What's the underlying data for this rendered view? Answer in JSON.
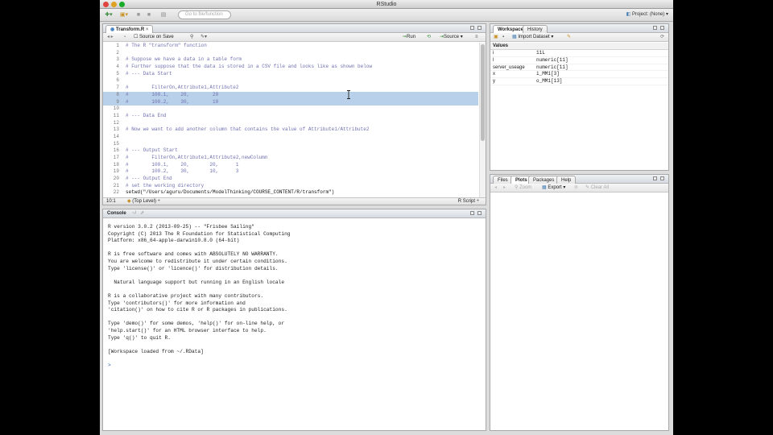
{
  "window": {
    "title": "RStudio"
  },
  "toolbar": {
    "goto_placeholder": "Go to file/function",
    "project": "Project: (None)"
  },
  "editor": {
    "tab": "Transform.R",
    "source_on_save": "Source on Save",
    "run": "Run",
    "source": "Source",
    "lines": [
      {
        "n": "1",
        "text": "# The R \"transform\" function",
        "kind": "comment",
        "sel": false
      },
      {
        "n": "2",
        "text": "",
        "kind": "plain",
        "sel": false
      },
      {
        "n": "3",
        "text": "# Suppose we have a data in a table form",
        "kind": "comment",
        "sel": false
      },
      {
        "n": "4",
        "text": "# Further suppose that the data is stored in a CSV file and looks like as shown below",
        "kind": "comment",
        "sel": false
      },
      {
        "n": "5",
        "text": "# --- Data Start",
        "kind": "comment",
        "sel": false
      },
      {
        "n": "6",
        "text": "",
        "kind": "plain",
        "sel": false
      },
      {
        "n": "7",
        "text": "#        FilterOn,Attribute1,Attribute2",
        "kind": "comment",
        "sel": false
      },
      {
        "n": "8",
        "text": "#        100.1,    20,        20",
        "kind": "comment",
        "sel": true
      },
      {
        "n": "9",
        "text": "#        100.2,    30,        10",
        "kind": "comment",
        "sel": true
      },
      {
        "n": "10",
        "text": "",
        "kind": "plain",
        "sel": false
      },
      {
        "n": "11",
        "text": "# --- Data End",
        "kind": "comment",
        "sel": false
      },
      {
        "n": "12",
        "text": "",
        "kind": "plain",
        "sel": false
      },
      {
        "n": "13",
        "text": "# Now we want to add another column that contains the value of Attribute1/Attribute2",
        "kind": "comment",
        "sel": false
      },
      {
        "n": "14",
        "text": "",
        "kind": "plain",
        "sel": false
      },
      {
        "n": "15",
        "text": "",
        "kind": "plain",
        "sel": false
      },
      {
        "n": "16",
        "text": "# --- Output Start",
        "kind": "comment",
        "sel": false
      },
      {
        "n": "17",
        "text": "#        FilterOn,Attribute1,Attribute2,newColumn",
        "kind": "comment",
        "sel": false
      },
      {
        "n": "18",
        "text": "#        100.1,    20,       20,      1",
        "kind": "comment",
        "sel": false
      },
      {
        "n": "19",
        "text": "#        100.2,    30,       10,      3",
        "kind": "comment",
        "sel": false
      },
      {
        "n": "20",
        "text": "# --- Output End",
        "kind": "comment",
        "sel": false
      },
      {
        "n": "21",
        "text": "# set the working directory",
        "kind": "comment",
        "sel": false
      },
      {
        "n": "22",
        "text": "setwd(\"/Users/aguru/Documents/ModelThinking/COURSE_CONTENT/R/transform\")",
        "kind": "plain",
        "sel": false
      }
    ],
    "status_pos": "10:1",
    "status_scope": "(Top Level) ÷",
    "status_type": "R Script ÷"
  },
  "console": {
    "tab": "Console",
    "path": "~/",
    "lines": [
      "R version 3.0.2 (2013-09-25) -- \"Frisbee Sailing\"",
      "Copyright (C) 2013 The R Foundation for Statistical Computing",
      "Platform: x86_64-apple-darwin10.8.0 (64-bit)",
      "",
      "R is free software and comes with ABSOLUTELY NO WARRANTY.",
      "You are welcome to redistribute it under certain conditions.",
      "Type 'license()' or 'licence()' for distribution details.",
      "",
      "  Natural language support but running in an English locale",
      "",
      "R is a collaborative project with many contributors.",
      "Type 'contributors()' for more information and",
      "'citation()' on how to cite R or R packages in publications.",
      "",
      "Type 'demo()' for some demos, 'help()' for on-line help, or",
      "'help.start()' for an HTML browser interface to help.",
      "Type 'q()' to quit R.",
      "",
      "[Workspace loaded from ~/.RData]",
      "",
      ">"
    ]
  },
  "workspace": {
    "tabs": [
      "Workspace",
      "History"
    ],
    "import_label": "Import Dataset",
    "section": "Values",
    "rows": [
      {
        "name": "i",
        "value": "11L"
      },
      {
        "name": "l",
        "value": "numeric[11]"
      },
      {
        "name": "server_useage",
        "value": "numeric[11]"
      },
      {
        "name": "x",
        "value": "i_MM1[3]"
      },
      {
        "name": "y",
        "value": "o_MM1[13]"
      }
    ]
  },
  "files": {
    "tabs": [
      "Files",
      "Plots",
      "Packages",
      "Help"
    ],
    "zoom": "Zoom",
    "export": "Export",
    "clear": "Clear All"
  }
}
